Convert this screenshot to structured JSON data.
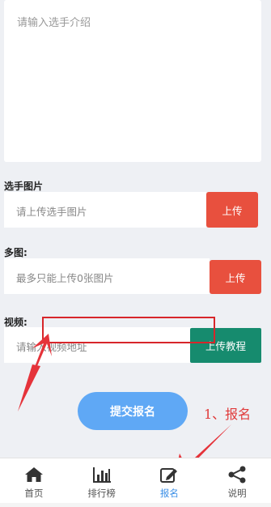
{
  "intro": {
    "placeholder": "请输入选手介绍"
  },
  "photo": {
    "label": "选手图片",
    "placeholder": "请上传选手图片",
    "button": "上传"
  },
  "multi": {
    "label": "多图:",
    "placeholder": "最多只能上传0张图片",
    "button": "上传"
  },
  "video": {
    "label": "视频:",
    "placeholder": "请输入视频地址",
    "button": "上传教程"
  },
  "submit": {
    "label": "提交报名"
  },
  "annotation": {
    "text": "1、报名",
    "color": "#e03a3a"
  },
  "tabs": [
    {
      "label": "首页",
      "icon": "home-icon"
    },
    {
      "label": "排行榜",
      "icon": "bar-chart-icon"
    },
    {
      "label": "报名",
      "icon": "edit-icon",
      "active": true
    },
    {
      "label": "说明",
      "icon": "share-icon"
    }
  ],
  "colors": {
    "red": "#e8503e",
    "teal": "#168b6e",
    "blue": "#5fa8f5",
    "active": "#3a8ee6"
  }
}
